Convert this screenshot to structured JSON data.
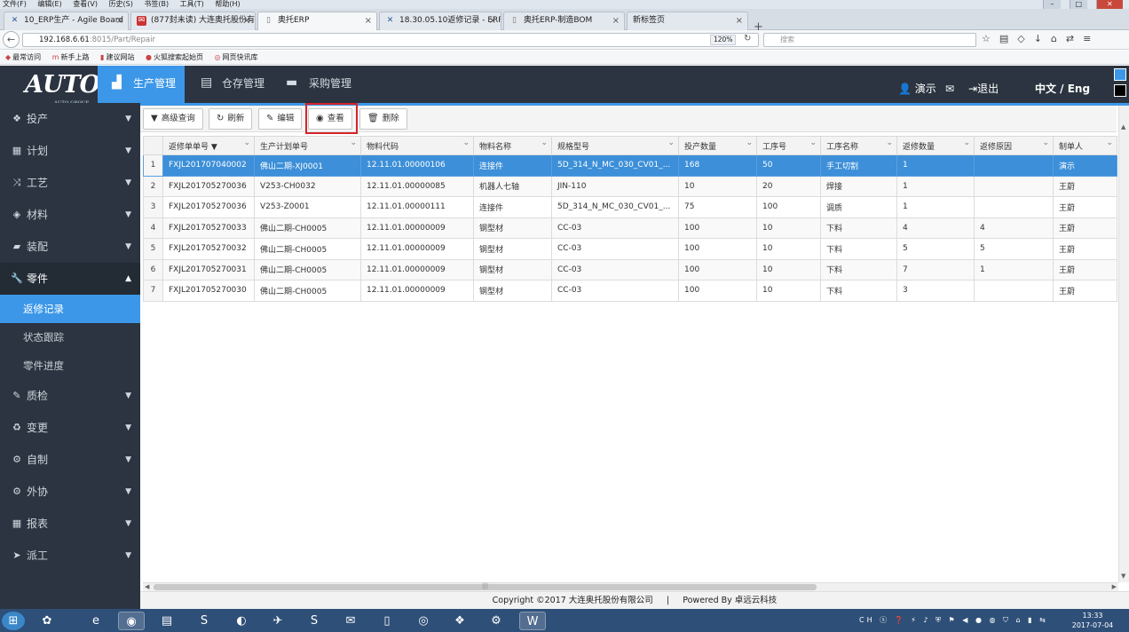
{
  "browser": {
    "menu": [
      "文件(F)",
      "编辑(E)",
      "查看(V)",
      "历史(S)",
      "书签(B)",
      "工具(T)",
      "帮助(H)"
    ],
    "tabs": [
      {
        "label": "10_ERP生产 - Agile Board",
        "icon": "jira-icon"
      },
      {
        "label": "(877封未读) 大连奥托股份有",
        "icon": "mail-icon"
      },
      {
        "label": "奥托ERP",
        "icon": "page-icon"
      },
      {
        "label": "18.30.05.10返修记录 - ERP",
        "icon": "jira-icon"
      },
      {
        "label": "奥托ERP-制造BOM",
        "icon": "page-icon"
      },
      {
        "label": "新标签页",
        "icon": ""
      }
    ],
    "url_host": "192.168.6.61",
    "url_rest": ":8015/Part/Repair",
    "zoom": "120%",
    "search_placeholder": "搜索",
    "bookmarks": [
      "最常访问",
      "新手上路",
      "建议网站",
      "火狐搜索起始页",
      "网页快讯库"
    ]
  },
  "app": {
    "logo": "AUTO",
    "logo_sub": "AUTO GROUP",
    "modules": [
      "生产管理",
      "仓存管理",
      "采购管理"
    ],
    "user": "演示",
    "logout": "退出",
    "language": "中文 / Eng"
  },
  "sidebar": {
    "items": [
      {
        "label": "投产",
        "icon": "cubes-icon"
      },
      {
        "label": "计划",
        "icon": "calendar-icon"
      },
      {
        "label": "工艺",
        "icon": "random-icon"
      },
      {
        "label": "材料",
        "icon": "eye-slash-icon"
      },
      {
        "label": "装配",
        "icon": "truck-icon"
      },
      {
        "label": "零件",
        "icon": "wrench-icon"
      },
      {
        "label": "质检",
        "icon": "pencil-icon"
      },
      {
        "label": "变更",
        "icon": "recycle-icon"
      },
      {
        "label": "自制",
        "icon": "gear-icon"
      },
      {
        "label": "外协",
        "icon": "gears-icon"
      },
      {
        "label": "报表",
        "icon": "table-icon"
      },
      {
        "label": "派工",
        "icon": "send-icon"
      }
    ],
    "sub": [
      "返修记录",
      "状态跟踪",
      "零件进度"
    ]
  },
  "toolbar": {
    "advanced_search": "高级查询",
    "refresh": "刷新",
    "edit": "编辑",
    "view": "查看",
    "delete": "删除"
  },
  "table": {
    "columns": [
      "返修单单号 ▼",
      "生产计划单号",
      "物料代码",
      "物料名称",
      "规格型号",
      "投产数量",
      "工序号",
      "工序名称",
      "返修数量",
      "返修原因",
      "制单人"
    ],
    "rows": [
      [
        "1",
        "FXJL201707040002",
        "佛山二期-XJ0001",
        "12.11.01.00000106",
        "连接件",
        "5D_314_N_MC_030_CV01_...",
        "168",
        "50",
        "手工切割",
        "1",
        "",
        "演示"
      ],
      [
        "2",
        "FXJL201705270036",
        "V253-CH0032",
        "12.11.01.00000085",
        "机器人七轴",
        "JIN-110",
        "10",
        "20",
        "焊接",
        "1",
        "",
        "王蔚"
      ],
      [
        "3",
        "FXJL201705270036",
        "V253-Z0001",
        "12.11.01.00000111",
        "连接件",
        "5D_314_N_MC_030_CV01_...",
        "75",
        "100",
        "调质",
        "1",
        "",
        "王蔚"
      ],
      [
        "4",
        "FXJL201705270033",
        "佛山二期-CH0005",
        "12.11.01.00000009",
        "钢型材",
        "CC-03",
        "100",
        "10",
        "下料",
        "4",
        "4",
        "王蔚"
      ],
      [
        "5",
        "FXJL201705270032",
        "佛山二期-CH0005",
        "12.11.01.00000009",
        "钢型材",
        "CC-03",
        "100",
        "10",
        "下料",
        "5",
        "5",
        "王蔚"
      ],
      [
        "6",
        "FXJL201705270031",
        "佛山二期-CH0005",
        "12.11.01.00000009",
        "钢型材",
        "CC-03",
        "100",
        "10",
        "下料",
        "7",
        "1",
        "王蔚"
      ],
      [
        "7",
        "FXJL201705270030",
        "佛山二期-CH0005",
        "12.11.01.00000009",
        "钢型材",
        "CC-03",
        "100",
        "10",
        "下料",
        "3",
        "",
        "王蔚"
      ]
    ]
  },
  "footer": {
    "copyright": "Copyright ©2017 大连奥托股份有限公司",
    "sep": "|",
    "powered": "Powered By 卓远云科技"
  },
  "taskbar": {
    "time": "13:33",
    "date": "2017-07-04"
  },
  "colors": {
    "accent": "#3c97e8",
    "header": "#2b3440",
    "highlight_box": "#d6232a"
  }
}
